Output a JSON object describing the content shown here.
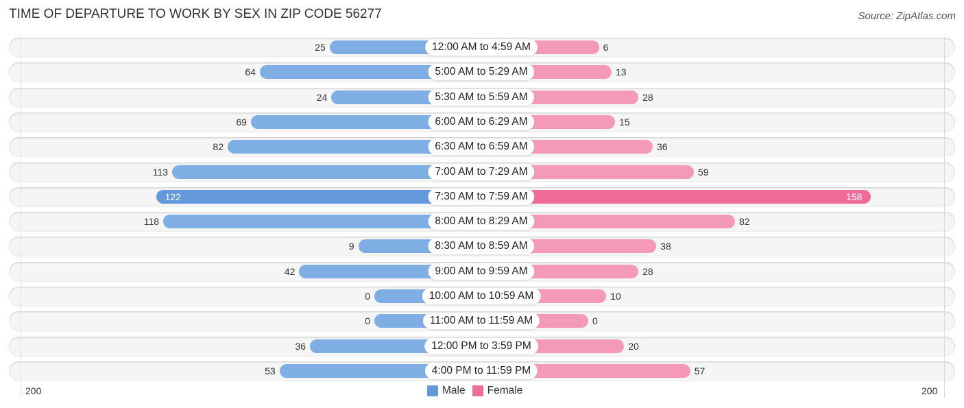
{
  "header": {
    "title": "TIME OF DEPARTURE TO WORK BY SEX IN ZIP CODE 56277",
    "source": "Source: ZipAtlas.com"
  },
  "colors": {
    "male": "#7eaee3",
    "male_highlight": "#6399dc",
    "female": "#f59ab6",
    "female_highlight": "#f06b97"
  },
  "legend": {
    "male_label": "Male",
    "female_label": "Female"
  },
  "chart_data": {
    "type": "bar",
    "orientation": "horizontal-diverging",
    "title": "TIME OF DEPARTURE TO WORK BY SEX IN ZIP CODE 56277",
    "categories": [
      "12:00 AM to 4:59 AM",
      "5:00 AM to 5:29 AM",
      "5:30 AM to 5:59 AM",
      "6:00 AM to 6:29 AM",
      "6:30 AM to 6:59 AM",
      "7:00 AM to 7:29 AM",
      "7:30 AM to 7:59 AM",
      "8:00 AM to 8:29 AM",
      "8:30 AM to 8:59 AM",
      "9:00 AM to 9:59 AM",
      "10:00 AM to 10:59 AM",
      "11:00 AM to 11:59 AM",
      "12:00 PM to 3:59 PM",
      "4:00 PM to 11:59 PM"
    ],
    "series": [
      {
        "name": "Male",
        "side": "left",
        "values": [
          25,
          64,
          24,
          69,
          82,
          113,
          122,
          118,
          9,
          42,
          0,
          0,
          36,
          53
        ]
      },
      {
        "name": "Female",
        "side": "right",
        "values": [
          6,
          13,
          28,
          15,
          36,
          59,
          158,
          82,
          38,
          28,
          10,
          0,
          20,
          57
        ]
      }
    ],
    "axis": {
      "left_max_label": "200",
      "right_max_label": "200",
      "range": [
        0,
        200
      ]
    },
    "legend_position": "bottom-center",
    "xlabel": "",
    "ylabel": ""
  }
}
